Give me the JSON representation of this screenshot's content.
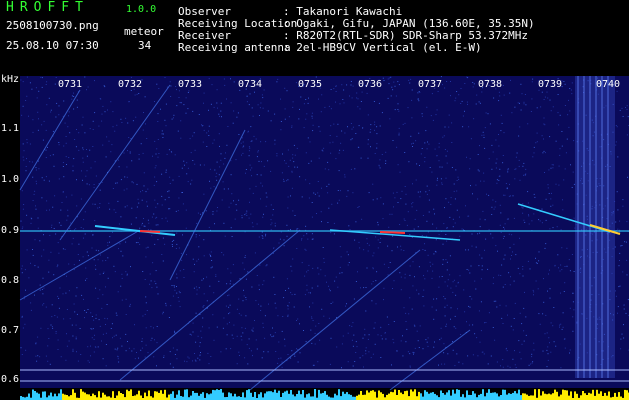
{
  "app": {
    "title": "HROFFT",
    "version": "1.0.0",
    "file_name": "2508100730.png",
    "date_time": "25.08.10 07:30",
    "meteor_label": "meteor",
    "meteor_count": "34"
  },
  "info": [
    {
      "label": "Observer",
      "value": ": Takanori Kawachi"
    },
    {
      "label": "Receiving Location",
      "value": ": Ogaki, Gifu, JAPAN (136.60E, 35.35N)"
    },
    {
      "label": "Receiver",
      "value": ": R820T2(RTL-SDR) SDR-Sharp 53.372MHz"
    },
    {
      "label": "Receiving antenna",
      "value": ": 2el-HB9CV Vertical (el. E-W)"
    }
  ],
  "axis": {
    "y_unit": "kHz",
    "y_ticks": [
      "1.1",
      "1.0",
      "0.9",
      "0.8",
      "0.7",
      "0.6"
    ],
    "x_ticks": [
      "0731",
      "0732",
      "0733",
      "0734",
      "0735",
      "0736",
      "0737",
      "0738",
      "0739",
      "0740"
    ]
  },
  "colors": {
    "background": "#000000",
    "spectrum_bg": "#0a0a5a",
    "header_green": "#33ff33",
    "text": "#ffffff",
    "signal": "#33ccff",
    "hot": "#ff3333",
    "bar_yellow": "#ffee00",
    "bar_cyan": "#33ccff"
  }
}
